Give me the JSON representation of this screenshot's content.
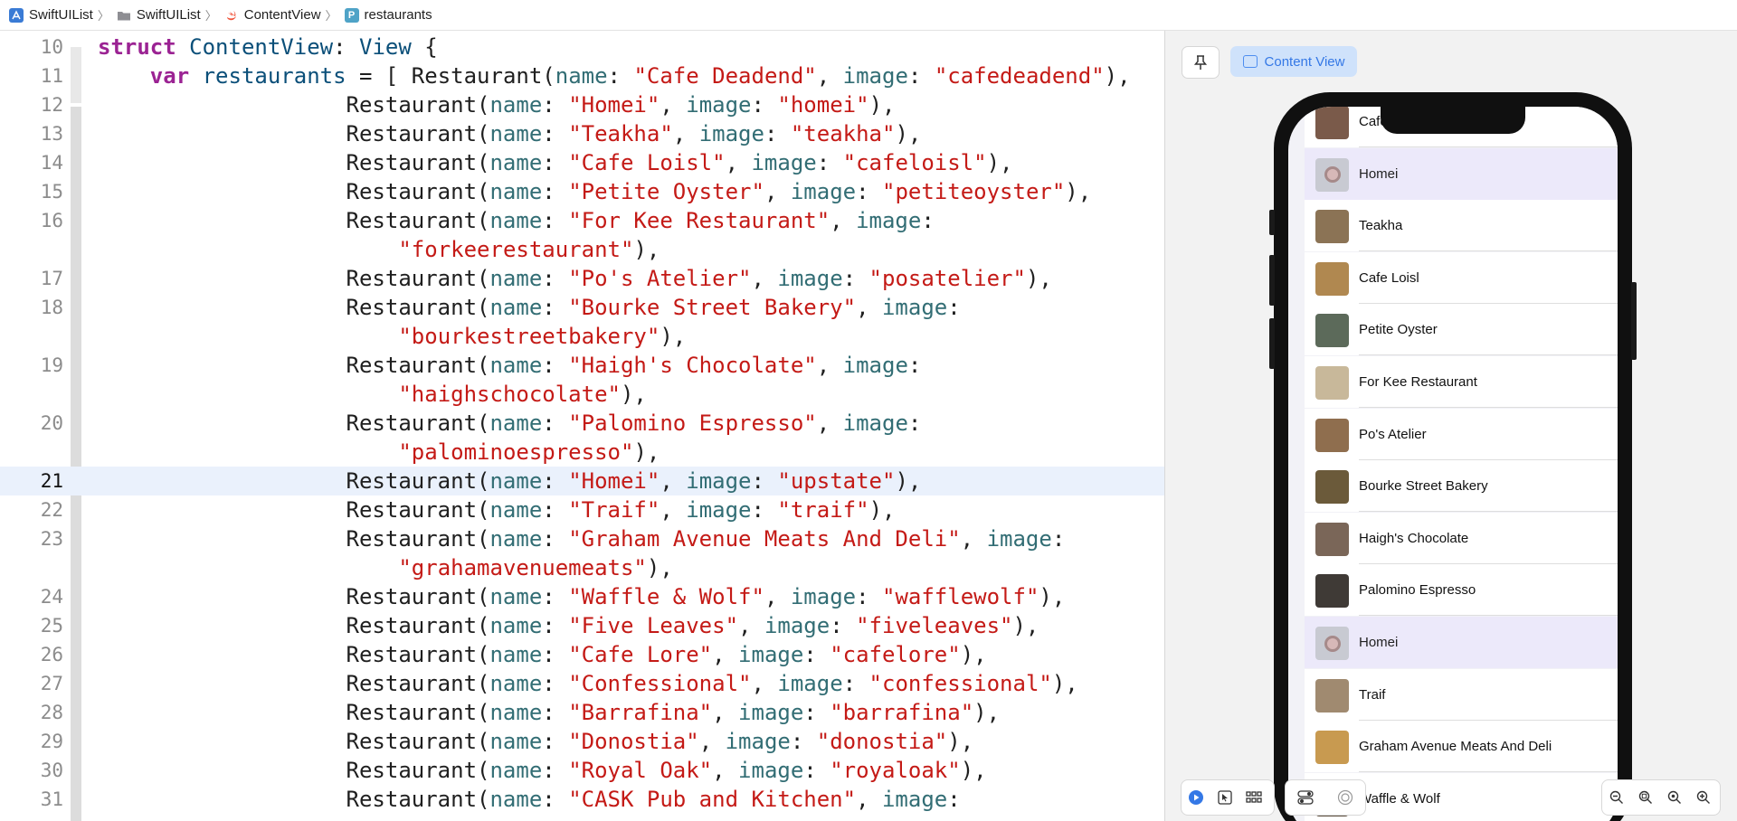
{
  "breadcrumb": {
    "items": [
      {
        "label": "SwiftUIList",
        "icon": "xcode-project-icon"
      },
      {
        "label": "SwiftUIList",
        "icon": "folder-icon"
      },
      {
        "label": "ContentView",
        "icon": "swift-file-icon"
      },
      {
        "label": "restaurants",
        "icon": "property-icon"
      }
    ]
  },
  "editor": {
    "current_line": 21,
    "lines": [
      {
        "num": "10",
        "segs": [
          [
            "kw",
            "struct"
          ],
          [
            "pl",
            " "
          ],
          [
            "ty",
            "ContentView"
          ],
          [
            "pl",
            ": "
          ],
          [
            "ty",
            "View"
          ],
          [
            "pl",
            " {"
          ]
        ]
      },
      {
        "num": "11",
        "segs": [
          [
            "pl",
            "    "
          ],
          [
            "kw",
            "var"
          ],
          [
            "pl",
            " "
          ],
          [
            "ty",
            "restaurants"
          ],
          [
            "pl",
            " = [ Restaurant("
          ],
          [
            "vr",
            "name"
          ],
          [
            "pl",
            ": "
          ],
          [
            "st",
            "\"Cafe Deadend\""
          ],
          [
            "pl",
            ", "
          ],
          [
            "vr",
            "image"
          ],
          [
            "pl",
            ": "
          ],
          [
            "st",
            "\"cafedeadend\""
          ],
          [
            "pl",
            "),"
          ]
        ]
      },
      {
        "num": "12",
        "segs": [
          [
            "pl",
            "                   Restaurant("
          ],
          [
            "vr",
            "name"
          ],
          [
            "pl",
            ": "
          ],
          [
            "st",
            "\"Homei\""
          ],
          [
            "pl",
            ", "
          ],
          [
            "vr",
            "image"
          ],
          [
            "pl",
            ": "
          ],
          [
            "st",
            "\"homei\""
          ],
          [
            "pl",
            "),"
          ]
        ]
      },
      {
        "num": "13",
        "segs": [
          [
            "pl",
            "                   Restaurant("
          ],
          [
            "vr",
            "name"
          ],
          [
            "pl",
            ": "
          ],
          [
            "st",
            "\"Teakha\""
          ],
          [
            "pl",
            ", "
          ],
          [
            "vr",
            "image"
          ],
          [
            "pl",
            ": "
          ],
          [
            "st",
            "\"teakha\""
          ],
          [
            "pl",
            "),"
          ]
        ]
      },
      {
        "num": "14",
        "segs": [
          [
            "pl",
            "                   Restaurant("
          ],
          [
            "vr",
            "name"
          ],
          [
            "pl",
            ": "
          ],
          [
            "st",
            "\"Cafe Loisl\""
          ],
          [
            "pl",
            ", "
          ],
          [
            "vr",
            "image"
          ],
          [
            "pl",
            ": "
          ],
          [
            "st",
            "\"cafeloisl\""
          ],
          [
            "pl",
            "),"
          ]
        ]
      },
      {
        "num": "15",
        "segs": [
          [
            "pl",
            "                   Restaurant("
          ],
          [
            "vr",
            "name"
          ],
          [
            "pl",
            ": "
          ],
          [
            "st",
            "\"Petite Oyster\""
          ],
          [
            "pl",
            ", "
          ],
          [
            "vr",
            "image"
          ],
          [
            "pl",
            ": "
          ],
          [
            "st",
            "\"petiteoyster\""
          ],
          [
            "pl",
            "),"
          ]
        ]
      },
      {
        "num": "16",
        "segs": [
          [
            "pl",
            "                   Restaurant("
          ],
          [
            "vr",
            "name"
          ],
          [
            "pl",
            ": "
          ],
          [
            "st",
            "\"For Kee Restaurant\""
          ],
          [
            "pl",
            ", "
          ],
          [
            "vr",
            "image"
          ],
          [
            "pl",
            ":"
          ]
        ]
      },
      {
        "num": "",
        "segs": [
          [
            "pl",
            "                       "
          ],
          [
            "st",
            "\"forkeerestaurant\""
          ],
          [
            "pl",
            "),"
          ]
        ]
      },
      {
        "num": "17",
        "segs": [
          [
            "pl",
            "                   Restaurant("
          ],
          [
            "vr",
            "name"
          ],
          [
            "pl",
            ": "
          ],
          [
            "st",
            "\"Po's Atelier\""
          ],
          [
            "pl",
            ", "
          ],
          [
            "vr",
            "image"
          ],
          [
            "pl",
            ": "
          ],
          [
            "st",
            "\"posatelier\""
          ],
          [
            "pl",
            "),"
          ]
        ]
      },
      {
        "num": "18",
        "segs": [
          [
            "pl",
            "                   Restaurant("
          ],
          [
            "vr",
            "name"
          ],
          [
            "pl",
            ": "
          ],
          [
            "st",
            "\"Bourke Street Bakery\""
          ],
          [
            "pl",
            ", "
          ],
          [
            "vr",
            "image"
          ],
          [
            "pl",
            ":"
          ]
        ]
      },
      {
        "num": "",
        "segs": [
          [
            "pl",
            "                       "
          ],
          [
            "st",
            "\"bourkestreetbakery\""
          ],
          [
            "pl",
            "),"
          ]
        ]
      },
      {
        "num": "19",
        "segs": [
          [
            "pl",
            "                   Restaurant("
          ],
          [
            "vr",
            "name"
          ],
          [
            "pl",
            ": "
          ],
          [
            "st",
            "\"Haigh's Chocolate\""
          ],
          [
            "pl",
            ", "
          ],
          [
            "vr",
            "image"
          ],
          [
            "pl",
            ":"
          ]
        ]
      },
      {
        "num": "",
        "segs": [
          [
            "pl",
            "                       "
          ],
          [
            "st",
            "\"haighschocolate\""
          ],
          [
            "pl",
            "),"
          ]
        ]
      },
      {
        "num": "20",
        "segs": [
          [
            "pl",
            "                   Restaurant("
          ],
          [
            "vr",
            "name"
          ],
          [
            "pl",
            ": "
          ],
          [
            "st",
            "\"Palomino Espresso\""
          ],
          [
            "pl",
            ", "
          ],
          [
            "vr",
            "image"
          ],
          [
            "pl",
            ":"
          ]
        ]
      },
      {
        "num": "",
        "segs": [
          [
            "pl",
            "                       "
          ],
          [
            "st",
            "\"palominoespresso\""
          ],
          [
            "pl",
            "),"
          ]
        ]
      },
      {
        "num": "21",
        "segs": [
          [
            "pl",
            "                   Restaurant("
          ],
          [
            "vr",
            "name"
          ],
          [
            "pl",
            ": "
          ],
          [
            "st",
            "\"Homei\""
          ],
          [
            "pl",
            ", "
          ],
          [
            "vr",
            "image"
          ],
          [
            "pl",
            ": "
          ],
          [
            "st",
            "\"upstate\""
          ],
          [
            "pl",
            "),"
          ]
        ]
      },
      {
        "num": "22",
        "segs": [
          [
            "pl",
            "                   Restaurant("
          ],
          [
            "vr",
            "name"
          ],
          [
            "pl",
            ": "
          ],
          [
            "st",
            "\"Traif\""
          ],
          [
            "pl",
            ", "
          ],
          [
            "vr",
            "image"
          ],
          [
            "pl",
            ": "
          ],
          [
            "st",
            "\"traif\""
          ],
          [
            "pl",
            "),"
          ]
        ]
      },
      {
        "num": "23",
        "segs": [
          [
            "pl",
            "                   Restaurant("
          ],
          [
            "vr",
            "name"
          ],
          [
            "pl",
            ": "
          ],
          [
            "st",
            "\"Graham Avenue Meats And Deli\""
          ],
          [
            "pl",
            ", "
          ],
          [
            "vr",
            "image"
          ],
          [
            "pl",
            ":"
          ]
        ]
      },
      {
        "num": "",
        "segs": [
          [
            "pl",
            "                       "
          ],
          [
            "st",
            "\"grahamavenuemeats\""
          ],
          [
            "pl",
            "),"
          ]
        ]
      },
      {
        "num": "24",
        "segs": [
          [
            "pl",
            "                   Restaurant("
          ],
          [
            "vr",
            "name"
          ],
          [
            "pl",
            ": "
          ],
          [
            "st",
            "\"Waffle & Wolf\""
          ],
          [
            "pl",
            ", "
          ],
          [
            "vr",
            "image"
          ],
          [
            "pl",
            ": "
          ],
          [
            "st",
            "\"wafflewolf\""
          ],
          [
            "pl",
            "),"
          ]
        ]
      },
      {
        "num": "25",
        "segs": [
          [
            "pl",
            "                   Restaurant("
          ],
          [
            "vr",
            "name"
          ],
          [
            "pl",
            ": "
          ],
          [
            "st",
            "\"Five Leaves\""
          ],
          [
            "pl",
            ", "
          ],
          [
            "vr",
            "image"
          ],
          [
            "pl",
            ": "
          ],
          [
            "st",
            "\"fiveleaves\""
          ],
          [
            "pl",
            "),"
          ]
        ]
      },
      {
        "num": "26",
        "segs": [
          [
            "pl",
            "                   Restaurant("
          ],
          [
            "vr",
            "name"
          ],
          [
            "pl",
            ": "
          ],
          [
            "st",
            "\"Cafe Lore\""
          ],
          [
            "pl",
            ", "
          ],
          [
            "vr",
            "image"
          ],
          [
            "pl",
            ": "
          ],
          [
            "st",
            "\"cafelore\""
          ],
          [
            "pl",
            "),"
          ]
        ]
      },
      {
        "num": "27",
        "segs": [
          [
            "pl",
            "                   Restaurant("
          ],
          [
            "vr",
            "name"
          ],
          [
            "pl",
            ": "
          ],
          [
            "st",
            "\"Confessional\""
          ],
          [
            "pl",
            ", "
          ],
          [
            "vr",
            "image"
          ],
          [
            "pl",
            ": "
          ],
          [
            "st",
            "\"confessional\""
          ],
          [
            "pl",
            "),"
          ]
        ]
      },
      {
        "num": "28",
        "segs": [
          [
            "pl",
            "                   Restaurant("
          ],
          [
            "vr",
            "name"
          ],
          [
            "pl",
            ": "
          ],
          [
            "st",
            "\"Barrafina\""
          ],
          [
            "pl",
            ", "
          ],
          [
            "vr",
            "image"
          ],
          [
            "pl",
            ": "
          ],
          [
            "st",
            "\"barrafina\""
          ],
          [
            "pl",
            "),"
          ]
        ]
      },
      {
        "num": "29",
        "segs": [
          [
            "pl",
            "                   Restaurant("
          ],
          [
            "vr",
            "name"
          ],
          [
            "pl",
            ": "
          ],
          [
            "st",
            "\"Donostia\""
          ],
          [
            "pl",
            ", "
          ],
          [
            "vr",
            "image"
          ],
          [
            "pl",
            ": "
          ],
          [
            "st",
            "\"donostia\""
          ],
          [
            "pl",
            "),"
          ]
        ]
      },
      {
        "num": "30",
        "segs": [
          [
            "pl",
            "                   Restaurant("
          ],
          [
            "vr",
            "name"
          ],
          [
            "pl",
            ": "
          ],
          [
            "st",
            "\"Royal Oak\""
          ],
          [
            "pl",
            ", "
          ],
          [
            "vr",
            "image"
          ],
          [
            "pl",
            ": "
          ],
          [
            "st",
            "\"royaloak\""
          ],
          [
            "pl",
            "),"
          ]
        ]
      },
      {
        "num": "31",
        "segs": [
          [
            "pl",
            "                   Restaurant("
          ],
          [
            "vr",
            "name"
          ],
          [
            "pl",
            ": "
          ],
          [
            "st",
            "\"CASK Pub and Kitchen\""
          ],
          [
            "pl",
            ", "
          ],
          [
            "vr",
            "image"
          ],
          [
            "pl",
            ":"
          ]
        ]
      }
    ]
  },
  "canvas": {
    "preview_label": "Content View",
    "list": [
      {
        "name": "Cafe D",
        "thumb": "#7a5a4a",
        "selected": false
      },
      {
        "name": "Homei",
        "thumb": "gray",
        "selected": true
      },
      {
        "name": "Teakha",
        "thumb": "#8b7355",
        "selected": false
      },
      {
        "name": "Cafe Loisl",
        "thumb": "#b08850",
        "selected": false
      },
      {
        "name": "Petite Oyster",
        "thumb": "#5c6a5a",
        "selected": false
      },
      {
        "name": "For Kee Restaurant",
        "thumb": "#c8b89a",
        "selected": false
      },
      {
        "name": "Po's Atelier",
        "thumb": "#8f6e4e",
        "selected": false
      },
      {
        "name": "Bourke Street Bakery",
        "thumb": "#6b5a3a",
        "selected": false
      },
      {
        "name": "Haigh's Chocolate",
        "thumb": "#7a6658",
        "selected": false
      },
      {
        "name": "Palomino Espresso",
        "thumb": "#3f3a36",
        "selected": false
      },
      {
        "name": "Homei",
        "thumb": "gray",
        "selected": true
      },
      {
        "name": "Traif",
        "thumb": "#a08a70",
        "selected": false
      },
      {
        "name": "Graham Avenue Meats And Deli",
        "thumb": "#c89a50",
        "selected": false
      },
      {
        "name": "Waffle & Wolf",
        "thumb": "#5a4a3a",
        "selected": false
      }
    ]
  },
  "colors": {
    "accent": "#3478e6",
    "keyword": "#9b2393",
    "string": "#c41a16",
    "param": "#326d74",
    "type": "#0b4f79"
  }
}
